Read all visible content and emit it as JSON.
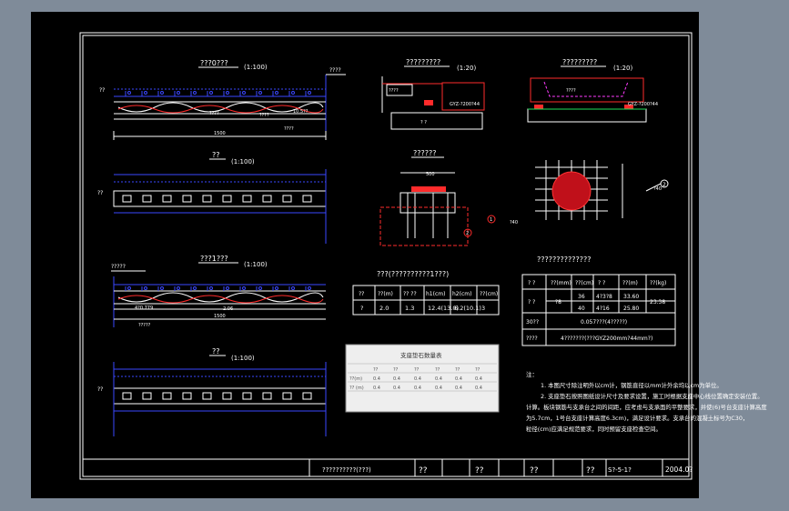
{
  "colors": {
    "frame": "#ffffff",
    "blue": "#3a47ff",
    "red": "#ff2b2b",
    "green": "#1fe05a",
    "magenta": "#ff3bff",
    "yellow": "#ffff40",
    "background": "#000000",
    "chrome": "#7f8b99"
  },
  "views": {
    "v1": {
      "title": "???0???",
      "scale": "(1:100)",
      "tag": "??",
      "side_label": "????",
      "small1": "????",
      "small2": "????",
      "dim1": "10.5??",
      "bottom": "1500"
    },
    "v2": {
      "title": "??",
      "scale": "(1:100)",
      "tag": "??"
    },
    "v3": {
      "title": "???1???",
      "scale": "(1:100)",
      "tag": "?????",
      "small1": "?????",
      "dim1": "4?0.779",
      "dim2": "2.06",
      "bottom": "1500"
    },
    "v4": {
      "title": "??",
      "scale": "(1:100)",
      "tag": "??"
    }
  },
  "details": {
    "d1": {
      "title": "?????????",
      "scale": "(1:20)",
      "label1": "????",
      "label2": "GYZ-?200?44",
      "label3": "? ?"
    },
    "d2": {
      "title": "?????????",
      "scale": "(1:20)",
      "label1": "????",
      "label2": "GYZ-?200?44"
    },
    "d3": {
      "title": "??????",
      "dim_top": "500",
      "callout1": "1",
      "callout2": "2"
    },
    "d4": {
      "callout": "2",
      "side": "?40",
      "dim": "?40"
    },
    "d5": {
      "title": "??????????????"
    }
  },
  "table1": {
    "title": "???(??????????1???)",
    "headers": [
      "??",
      "??(m)",
      "?? ??",
      "h1(cm)",
      "h2(cm)",
      "??(cm)"
    ],
    "row": [
      "?",
      "2.0",
      "1.3",
      "12.4(13.0)",
      "6.2(10.1)",
      "3"
    ]
  },
  "table2": {
    "title": "??????????????",
    "r1": [
      "? ?",
      "??(mm)",
      "??(cm)",
      "? ?",
      "??(m)",
      "??(kg)"
    ],
    "r2a": [
      "? ?",
      "?8",
      "36",
      "4?3?8",
      "33.60",
      "23.38"
    ],
    "r2b": [
      "40",
      "4?16",
      "25.80"
    ],
    "r3": [
      "30??",
      "0.057???(4?????)"
    ],
    "r4": [
      "????",
      "4???????(???GYZ200mm?44mm?)"
    ]
  },
  "table3": {
    "title": "支座垫石数量表",
    "header": [
      "",
      "??",
      "??",
      "??",
      "??",
      "??",
      "??"
    ],
    "rows": [
      [
        "??(m)",
        "0.4",
        "0.4",
        "0.4",
        "0.4",
        "0.4",
        "0.4"
      ],
      [
        "?? (m)",
        "0.4",
        "0.4",
        "0.4",
        "0.4",
        "0.4",
        "0.4"
      ]
    ]
  },
  "notes": [
    "注：",
    "1. 本图尺寸除注明外以cm计，钢筋直径以mm计外余均以cm为单位。",
    "2. 支座垫石按照图纸设计尺寸及要求设置，施工时根据支座中心线位置确定安装位置。",
    "计算。板块钢筋与支承台之间的间距，应考虑与支承面的平整要求，并使(6)号台支座计算高度",
    "为5.7cm，1号台支座计算高度6.3cm)，满足设计要求。支承台的混凝土标号为C30，",
    "粒径(cm)应满足规范要求，同时预留支座检查空间。"
  ],
  "title_block": {
    "drawing_name": "??????????(???)",
    "c1": "??",
    "c2": "??",
    "c3": "??",
    "c4": "??",
    "sheet": "S?-5-1?",
    "date": "2004.0?"
  }
}
